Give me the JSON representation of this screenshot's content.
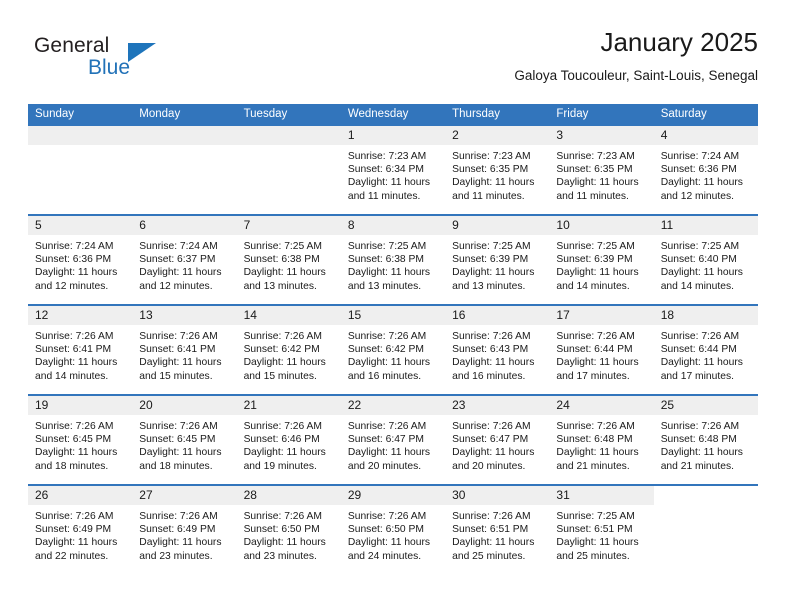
{
  "logo": {
    "word_top": "General",
    "word_bottom": "Blue",
    "triangle_color": "#1e74bb",
    "text_color": "#231f20",
    "blue_color": "#2272b8"
  },
  "header": {
    "title": "January 2025",
    "subtitle": "Galoya Toucouleur, Saint-Louis, Senegal"
  },
  "theme": {
    "header_bg": "#3275bc",
    "header_text": "#ffffff",
    "daynum_band_bg": "#efefef",
    "cell_bg": "#ffffff",
    "row_divider": "#3275bc"
  },
  "calendar": {
    "weekday_headers": [
      "Sunday",
      "Monday",
      "Tuesday",
      "Wednesday",
      "Thursday",
      "Friday",
      "Saturday"
    ],
    "weeks": [
      [
        {
          "day": "",
          "empty": true,
          "lines": []
        },
        {
          "day": "",
          "empty": true,
          "lines": []
        },
        {
          "day": "",
          "empty": true,
          "lines": []
        },
        {
          "day": "1",
          "lines": [
            "Sunrise: 7:23 AM",
            "Sunset: 6:34 PM",
            "Daylight: 11 hours",
            "and 11 minutes."
          ]
        },
        {
          "day": "2",
          "lines": [
            "Sunrise: 7:23 AM",
            "Sunset: 6:35 PM",
            "Daylight: 11 hours",
            "and 11 minutes."
          ]
        },
        {
          "day": "3",
          "lines": [
            "Sunrise: 7:23 AM",
            "Sunset: 6:35 PM",
            "Daylight: 11 hours",
            "and 11 minutes."
          ]
        },
        {
          "day": "4",
          "lines": [
            "Sunrise: 7:24 AM",
            "Sunset: 6:36 PM",
            "Daylight: 11 hours",
            "and 12 minutes."
          ]
        }
      ],
      [
        {
          "day": "5",
          "lines": [
            "Sunrise: 7:24 AM",
            "Sunset: 6:36 PM",
            "Daylight: 11 hours",
            "and 12 minutes."
          ]
        },
        {
          "day": "6",
          "lines": [
            "Sunrise: 7:24 AM",
            "Sunset: 6:37 PM",
            "Daylight: 11 hours",
            "and 12 minutes."
          ]
        },
        {
          "day": "7",
          "lines": [
            "Sunrise: 7:25 AM",
            "Sunset: 6:38 PM",
            "Daylight: 11 hours",
            "and 13 minutes."
          ]
        },
        {
          "day": "8",
          "lines": [
            "Sunrise: 7:25 AM",
            "Sunset: 6:38 PM",
            "Daylight: 11 hours",
            "and 13 minutes."
          ]
        },
        {
          "day": "9",
          "lines": [
            "Sunrise: 7:25 AM",
            "Sunset: 6:39 PM",
            "Daylight: 11 hours",
            "and 13 minutes."
          ]
        },
        {
          "day": "10",
          "lines": [
            "Sunrise: 7:25 AM",
            "Sunset: 6:39 PM",
            "Daylight: 11 hours",
            "and 14 minutes."
          ]
        },
        {
          "day": "11",
          "lines": [
            "Sunrise: 7:25 AM",
            "Sunset: 6:40 PM",
            "Daylight: 11 hours",
            "and 14 minutes."
          ]
        }
      ],
      [
        {
          "day": "12",
          "lines": [
            "Sunrise: 7:26 AM",
            "Sunset: 6:41 PM",
            "Daylight: 11 hours",
            "and 14 minutes."
          ]
        },
        {
          "day": "13",
          "lines": [
            "Sunrise: 7:26 AM",
            "Sunset: 6:41 PM",
            "Daylight: 11 hours",
            "and 15 minutes."
          ]
        },
        {
          "day": "14",
          "lines": [
            "Sunrise: 7:26 AM",
            "Sunset: 6:42 PM",
            "Daylight: 11 hours",
            "and 15 minutes."
          ]
        },
        {
          "day": "15",
          "lines": [
            "Sunrise: 7:26 AM",
            "Sunset: 6:42 PM",
            "Daylight: 11 hours",
            "and 16 minutes."
          ]
        },
        {
          "day": "16",
          "lines": [
            "Sunrise: 7:26 AM",
            "Sunset: 6:43 PM",
            "Daylight: 11 hours",
            "and 16 minutes."
          ]
        },
        {
          "day": "17",
          "lines": [
            "Sunrise: 7:26 AM",
            "Sunset: 6:44 PM",
            "Daylight: 11 hours",
            "and 17 minutes."
          ]
        },
        {
          "day": "18",
          "lines": [
            "Sunrise: 7:26 AM",
            "Sunset: 6:44 PM",
            "Daylight: 11 hours",
            "and 17 minutes."
          ]
        }
      ],
      [
        {
          "day": "19",
          "lines": [
            "Sunrise: 7:26 AM",
            "Sunset: 6:45 PM",
            "Daylight: 11 hours",
            "and 18 minutes."
          ]
        },
        {
          "day": "20",
          "lines": [
            "Sunrise: 7:26 AM",
            "Sunset: 6:45 PM",
            "Daylight: 11 hours",
            "and 18 minutes."
          ]
        },
        {
          "day": "21",
          "lines": [
            "Sunrise: 7:26 AM",
            "Sunset: 6:46 PM",
            "Daylight: 11 hours",
            "and 19 minutes."
          ]
        },
        {
          "day": "22",
          "lines": [
            "Sunrise: 7:26 AM",
            "Sunset: 6:47 PM",
            "Daylight: 11 hours",
            "and 20 minutes."
          ]
        },
        {
          "day": "23",
          "lines": [
            "Sunrise: 7:26 AM",
            "Sunset: 6:47 PM",
            "Daylight: 11 hours",
            "and 20 minutes."
          ]
        },
        {
          "day": "24",
          "lines": [
            "Sunrise: 7:26 AM",
            "Sunset: 6:48 PM",
            "Daylight: 11 hours",
            "and 21 minutes."
          ]
        },
        {
          "day": "25",
          "lines": [
            "Sunrise: 7:26 AM",
            "Sunset: 6:48 PM",
            "Daylight: 11 hours",
            "and 21 minutes."
          ]
        }
      ],
      [
        {
          "day": "26",
          "lines": [
            "Sunrise: 7:26 AM",
            "Sunset: 6:49 PM",
            "Daylight: 11 hours",
            "and 22 minutes."
          ]
        },
        {
          "day": "27",
          "lines": [
            "Sunrise: 7:26 AM",
            "Sunset: 6:49 PM",
            "Daylight: 11 hours",
            "and 23 minutes."
          ]
        },
        {
          "day": "28",
          "lines": [
            "Sunrise: 7:26 AM",
            "Sunset: 6:50 PM",
            "Daylight: 11 hours",
            "and 23 minutes."
          ]
        },
        {
          "day": "29",
          "lines": [
            "Sunrise: 7:26 AM",
            "Sunset: 6:50 PM",
            "Daylight: 11 hours",
            "and 24 minutes."
          ]
        },
        {
          "day": "30",
          "lines": [
            "Sunrise: 7:26 AM",
            "Sunset: 6:51 PM",
            "Daylight: 11 hours",
            "and 25 minutes."
          ]
        },
        {
          "day": "31",
          "lines": [
            "Sunrise: 7:25 AM",
            "Sunset: 6:51 PM",
            "Daylight: 11 hours",
            "and 25 minutes."
          ]
        },
        {
          "day": "",
          "blank": true,
          "lines": []
        }
      ]
    ]
  }
}
